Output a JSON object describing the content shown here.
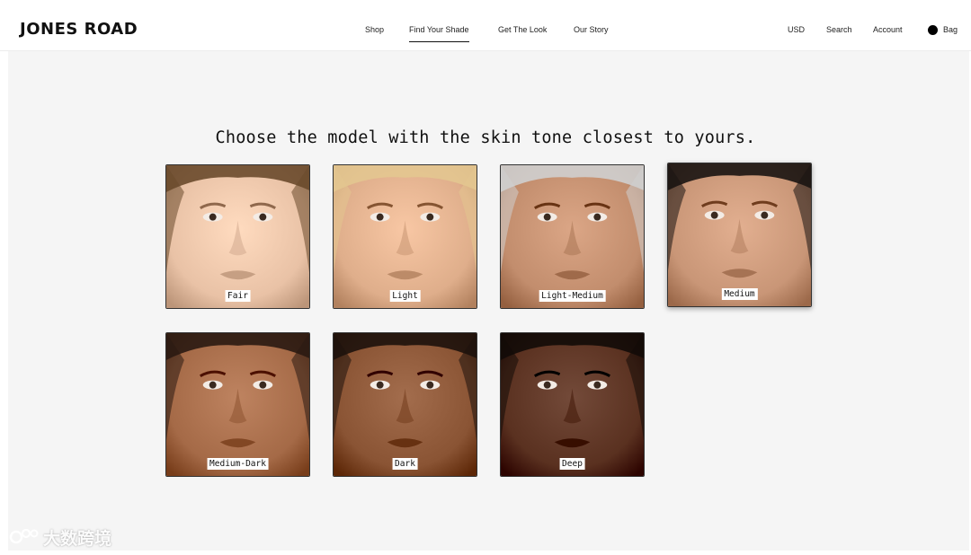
{
  "brand": {
    "logo": "JONES ROAD"
  },
  "nav": {
    "items": [
      "Shop",
      "Find Your Shade",
      "Get The Look",
      "Our Story"
    ],
    "active": "Find Your Shade"
  },
  "utility": {
    "currency": "USD",
    "search": "Search",
    "account": "Account",
    "bag": "Bag"
  },
  "main": {
    "heading": "Choose the model with the skin tone closest to yours."
  },
  "shades": [
    {
      "label": "Fair",
      "skin": "#e9c2a6",
      "hair": "#6a4a2c"
    },
    {
      "label": "Light",
      "skin": "#dfae8b",
      "hair": "#e3c690"
    },
    {
      "label": "Light-Medium",
      "skin": "#c28d6d",
      "hair": "#cfcfcf"
    },
    {
      "label": "Medium",
      "skin": "#c99677",
      "hair": "#1a1412"
    },
    {
      "label": "Medium-Dark",
      "skin": "#a56a47",
      "hair": "#2a1a12"
    },
    {
      "label": "Dark",
      "skin": "#8a5434",
      "hair": "#1d120c"
    },
    {
      "label": "Deep",
      "skin": "#5a3120",
      "hair": "#120b08"
    }
  ],
  "watermark": {
    "text": "大数跨境"
  }
}
